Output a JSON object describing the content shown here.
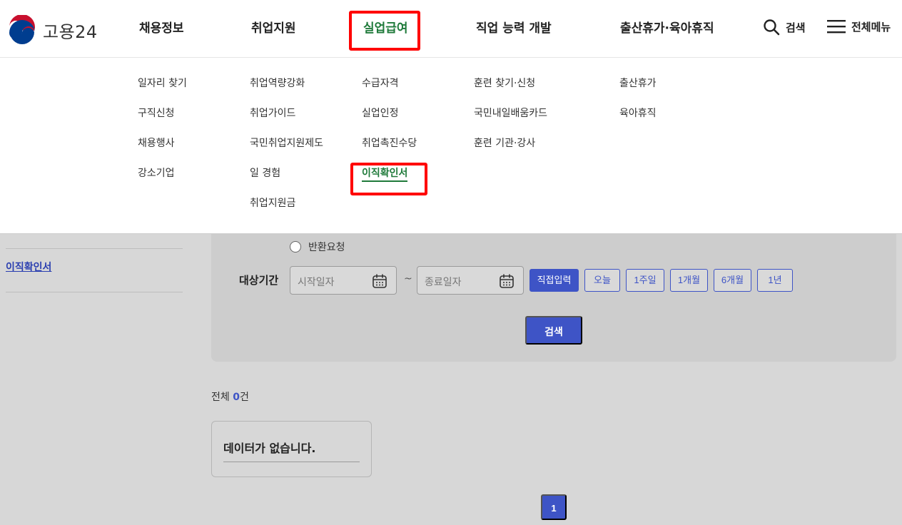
{
  "header": {
    "logo_text": "고용24",
    "nav": [
      "채용정보",
      "취업지원",
      "실업급여",
      "직업 능력 개발",
      "출산휴가·육아휴직"
    ],
    "active_nav": "실업급여",
    "search_label": "검색",
    "menu_label": "전체메뉴"
  },
  "mega_menu": {
    "columns": [
      [
        "일자리 찾기",
        "구직신청",
        "채용행사",
        "강소기업"
      ],
      [
        "취업역량강화",
        "취업가이드",
        "국민취업지원제도",
        "일 경험",
        "취업지원금"
      ],
      [
        "수급자격",
        "실업인정",
        "취업촉진수당",
        "이직확인서"
      ],
      [
        "훈련 찾기·신청",
        "국민내일배움카드",
        "훈련 기관·강사"
      ],
      [
        "출산휴가",
        "육아휴직"
      ]
    ],
    "current_item": "이직확인서"
  },
  "sidebar": {
    "current_link": "이직확인서"
  },
  "search_form": {
    "radio_label": "반환요청",
    "period_label": "대상기간",
    "start_placeholder": "시작일자",
    "end_placeholder": "종료일자",
    "range_separator": "~",
    "chips": [
      "직접입력",
      "오늘",
      "1주일",
      "1개월",
      "6개월",
      "1년"
    ],
    "selected_chip": "직접입력",
    "search_button": "검색"
  },
  "results": {
    "total_prefix": "전체",
    "total_count": "0",
    "total_suffix": "건",
    "empty_message": "데이터가 없습니다."
  },
  "pagination": {
    "current_page": "1"
  },
  "colors": {
    "accent_blue": "#3e54c6",
    "active_green": "#1f7a3a",
    "highlight_red": "#ff0000"
  }
}
